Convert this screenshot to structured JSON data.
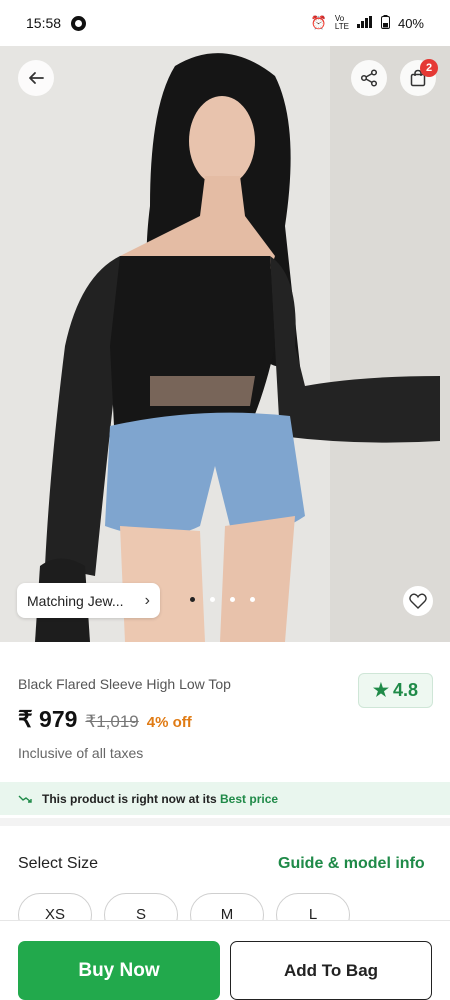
{
  "status_bar": {
    "time": "15:58",
    "battery": "40%",
    "icons": [
      "whatsapp-icon",
      "alarm-icon",
      "volte-icon",
      "signal-icon",
      "battery-icon"
    ]
  },
  "hero": {
    "image_description_icon": "product-photo",
    "matching_chip_label": "Matching Jew...",
    "cart_count": "2",
    "carousel": {
      "total": 4,
      "active_index": 0
    }
  },
  "product": {
    "title": "Black Flared Sleeve High Low Top",
    "rating": "4.8",
    "price": "₹ 979",
    "mrp": "₹1,019",
    "discount": "4% off",
    "tax_note": "Inclusive of all taxes"
  },
  "best_price": {
    "text": "This product is right now at its",
    "highlight": "Best price"
  },
  "size": {
    "label": "Select Size",
    "guide": "Guide & model info",
    "options": [
      "XS",
      "S",
      "M",
      "L"
    ]
  },
  "actions": {
    "buy_now": "Buy Now",
    "add_to_bag": "Add To Bag"
  },
  "colors": {
    "accent_green": "#22a94c",
    "discount_orange": "#e07b14",
    "badge_red": "#e53935"
  }
}
